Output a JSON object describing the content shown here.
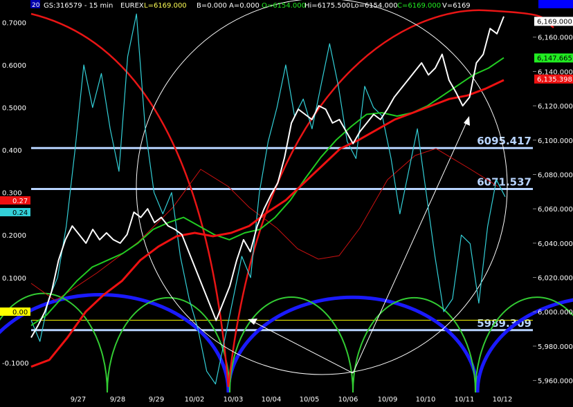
{
  "header": {
    "badge": "20",
    "symbol": "GS:316579 - 15 min",
    "exchange": "EUREX",
    "last": "L=6169.000",
    "bid": "B=0.000",
    "ask": "A=0.000",
    "open": "O=6154.000",
    "high": "Hi=6175.500",
    "low": "Lo=6154.000",
    "close": "C=6169.000",
    "volume": "V=6169"
  },
  "colors": {
    "background": "#000000",
    "price": "#ffffff",
    "indicator": "#33d0d8",
    "ma_fast": "#22cc22",
    "ma_slow": "#ee1111",
    "ma_thin": "#cc1111",
    "cycle_blue": "#1a1aff",
    "cycle_green": "#33cc33",
    "cycle_red": "#e81515",
    "level_line": "#b8d4ff",
    "zero_line": "#ffff00",
    "axis_text": "#ffffff"
  },
  "chart_data": {
    "type": "line",
    "x_ticks": [
      "9/27",
      "9/28",
      "9/29",
      "10/02",
      "10/03",
      "10/04",
      "10/05",
      "10/06",
      "10/09",
      "10/10",
      "10/11",
      "10/12"
    ],
    "left_axis": {
      "ticks": [
        "0.7000",
        "0.6000",
        "0.5000",
        "0.400",
        "0.300",
        "0.2000",
        "0.1000",
        "0.00",
        "-0.1000"
      ],
      "range": [
        -0.17,
        0.73
      ]
    },
    "right_axis": {
      "ticks": [
        "6,160.000",
        "6,140.000",
        "6,120.000",
        "6,100.000",
        "6,080.000",
        "6,060.000",
        "6,040.000",
        "6,020.000",
        "6,000.000",
        "5,980.000",
        "5,960.000"
      ],
      "range": [
        5953,
        6176
      ]
    },
    "price_labels": [
      {
        "text": "6,169.000",
        "value": 6169
      },
      {
        "text": "6,147.665",
        "value": 6147.665
      },
      {
        "text": "6,135.398",
        "value": 6135.398
      }
    ],
    "indicator_labels": [
      {
        "text": "0.27",
        "value": 0.27
      },
      {
        "text": "0.24",
        "value": 0.24
      },
      {
        "text": "0.00",
        "value": 0.0
      }
    ],
    "levels": [
      {
        "label": "6095.417",
        "value": 6095.417
      },
      {
        "label": "6071.537",
        "value": 6071.537
      },
      {
        "label": "5989.309",
        "value": 5989.309
      }
    ],
    "series": [
      {
        "role": "price",
        "values": [
          5985,
          5992,
          6000,
          6012,
          6030,
          6042,
          6050,
          6045,
          6040,
          6048,
          6042,
          6046,
          6042,
          6040,
          6045,
          6058,
          6055,
          6060,
          6052,
          6055,
          6050,
          6048,
          6045,
          6035,
          6025,
          6015,
          6005,
          5995,
          6005,
          6015,
          6030,
          6042,
          6035,
          6050,
          6060,
          6068,
          6075,
          6090,
          6110,
          6118,
          6115,
          6112,
          6120,
          6118,
          6110,
          6112,
          6105,
          6098,
          6105,
          6110,
          6115,
          6112,
          6118,
          6125,
          6130,
          6135,
          6140,
          6145,
          6138,
          6142,
          6150,
          6135,
          6128,
          6120,
          6125,
          6145,
          6150,
          6165,
          6162,
          6172
        ]
      },
      {
        "role": "indicator",
        "values": [
          0.0,
          -0.05,
          0.05,
          0.1,
          0.22,
          0.4,
          0.6,
          0.5,
          0.58,
          0.45,
          0.35,
          0.62,
          0.72,
          0.45,
          0.3,
          0.25,
          0.3,
          0.15,
          0.05,
          -0.02,
          -0.12,
          -0.15,
          -0.05,
          0.05,
          0.15,
          0.1,
          0.3,
          0.42,
          0.5,
          0.6,
          0.48,
          0.52,
          0.45,
          0.55,
          0.65,
          0.55,
          0.42,
          0.38,
          0.55,
          0.5,
          0.48,
          0.38,
          0.25,
          0.35,
          0.45,
          0.3,
          0.15,
          0.02,
          0.05,
          0.2,
          0.18,
          0.04,
          0.22,
          0.33,
          0.29
        ]
      },
      {
        "role": "ma_fast",
        "values": [
          5992,
          5998,
          6008,
          6018,
          6026,
          6030,
          6034,
          6040,
          6048,
          6052,
          6055,
          6050,
          6045,
          6042,
          6046,
          6048,
          6055,
          6065,
          6078,
          6090,
          6100,
          6108,
          6115,
          6116,
          6114,
          6116,
          6120,
          6126,
          6132,
          6138,
          6142,
          6148
        ]
      },
      {
        "role": "ma_slow",
        "values": [
          5968,
          5972,
          5985,
          6000,
          6010,
          6018,
          6030,
          6038,
          6044,
          6046,
          6044,
          6046,
          6050,
          6058,
          6065,
          6075,
          6085,
          6095,
          6100,
          6106,
          6112,
          6116,
          6120,
          6124,
          6126,
          6130,
          6135
        ]
      }
    ]
  }
}
